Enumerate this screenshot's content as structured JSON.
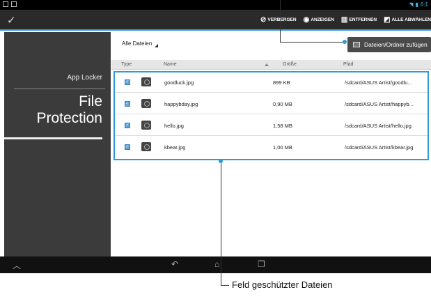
{
  "statusbar": {
    "time": "6:1"
  },
  "actionbar": {
    "actions": [
      {
        "label": "VERBERGEN",
        "icon": "eye-slash-icon"
      },
      {
        "label": "ANZEIGEN",
        "icon": "eye-icon"
      },
      {
        "label": "ENTFERNEN",
        "icon": "trash-icon"
      },
      {
        "label": "ALLE ABWÄHLEN",
        "icon": "select-icon"
      }
    ]
  },
  "sidebar": {
    "app_name": "App Locker",
    "title_line1": "File",
    "title_line2": "Protection"
  },
  "main": {
    "filter_label": "Alle Dateien",
    "add_button_label": "Dateien/Ordner zufügen",
    "columns": {
      "type": "Type",
      "name": "Name",
      "size": "Größe",
      "path": "Pfad"
    },
    "rows": [
      {
        "name": "goodluck.jpg",
        "size": "899 KB",
        "path": "/sdcard/ASUS Artist/goodlu..."
      },
      {
        "name": "happybday.jpg",
        "size": "0,90 MB",
        "path": "/sdcard/ASUS Artist/happyb..."
      },
      {
        "name": "hello.jpg",
        "size": "1,58 MB",
        "path": "/sdcard/ASUS Artist/hello.jpg"
      },
      {
        "name": "kbear.jpg",
        "size": "1,00 MB",
        "path": "/sdcard/ASUS Artist/kbear.jpg"
      }
    ]
  },
  "caption": {
    "protected_files": "Feld geschützter Dateien"
  },
  "colors": {
    "accent": "#2e9bd6",
    "sidebar": "#3b3b3b",
    "actionbar": "#2a2a2a"
  }
}
